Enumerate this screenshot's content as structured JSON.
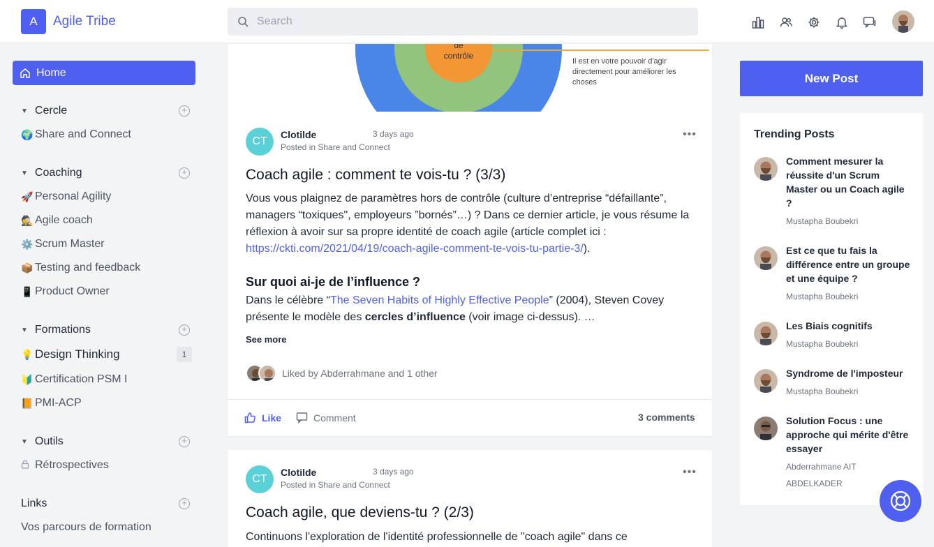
{
  "header": {
    "logo_letter": "A",
    "brand": "Agile Tribe",
    "search_placeholder": "Search",
    "icons": [
      "analytics-icon",
      "members-icon",
      "settings-icon",
      "bell-icon",
      "chat-icon"
    ]
  },
  "sidebar": {
    "home": "Home",
    "sections": [
      {
        "title": "Cercle",
        "items": [
          {
            "emoji": "🌍",
            "label": "Share and Connect"
          }
        ]
      },
      {
        "title": "Coaching",
        "items": [
          {
            "emoji": "🚀",
            "label": "Personal Agility"
          },
          {
            "emoji": "🕵️",
            "label": "Agile coach"
          },
          {
            "emoji": "⚙️",
            "label": "Scrum Master"
          },
          {
            "emoji": "📦",
            "label": "Testing and feedback"
          },
          {
            "emoji": "📱",
            "label": "Product Owner"
          }
        ]
      },
      {
        "title": "Formations",
        "items": [
          {
            "emoji": "💡",
            "label": "Design Thinking",
            "badge": "1"
          },
          {
            "emoji": "🔰",
            "label": "Certification PSM I"
          },
          {
            "emoji": "📙",
            "label": "PMI-ACP"
          }
        ]
      },
      {
        "title": "Outils",
        "items": [
          {
            "emoji": "🔒",
            "label": "Rétrospectives"
          }
        ]
      }
    ],
    "links_title": "Links",
    "links": [
      "Vos parcours de formation"
    ]
  },
  "feed": {
    "image_label_1": "de",
    "image_label_2": "contrôle",
    "image_caption": "Il est en votre pouvoir d'agir directement pour améliorer les choses",
    "posts": [
      {
        "avatar": "CT",
        "author": "Clotilde",
        "time": "3 days ago",
        "posted_in": "Posted in Share and Connect",
        "title": "Coach agile : comment te vois-tu ? (3/3)",
        "body": "Vous vous plaignez de paramètres hors de contrôle (culture d’entreprise “défaillante”, managers “toxiques\", employeurs ”bornés”…) ? Dans ce dernier article, je vous résume la réflexion à avoir sur sa propre identité de coach agile (article complet ici : ",
        "link": "https://ckti.com/2021/04/19/coach-agile-comment-te-vois-tu-partie-3/",
        "body_end": ").",
        "subheading": "Sur quoi ai-je de l’influence ?",
        "para2_a": "Dans le célèbre “",
        "para2_link": "The Seven Habits of Highly Effective People",
        "para2_b": "” (2004), Steven Covey présente le modèle des ",
        "para2_bold": "cercles d’influence",
        "para2_c": " (voir image ci-dessus). …",
        "see_more": "See more",
        "liked_by": "Liked by Abderrahmane and 1 other",
        "like": "Like",
        "comment": "Comment",
        "comments_count": "3 comments"
      },
      {
        "avatar": "CT",
        "author": "Clotilde",
        "time": "3 days ago",
        "posted_in": "Posted in Share and Connect",
        "title": "Coach agile, que deviens-tu ? (2/3)",
        "body": "Continuons l'exploration de l'identité professionnelle de \"coach agile\" dans ce"
      }
    ]
  },
  "right": {
    "new_post": "New Post",
    "trending_title": "Trending Posts",
    "trending": [
      {
        "title": "Comment mesurer la réussite d'un Scrum Master ou un Coach agile ?",
        "author": "Mustapha Boubekri"
      },
      {
        "title": "Est ce que tu fais la différence entre un groupe et une équipe ?",
        "author": "Mustapha Boubekri"
      },
      {
        "title": "Les Biais cognitifs",
        "author": "Mustapha Boubekri"
      },
      {
        "title": "Syndrome de l'imposteur",
        "author": "Mustapha Boubekri"
      },
      {
        "title": "Solution Focus : une approche qui mérite d'être essayer",
        "author": "Abderrahmane AIT ABDELKADER"
      }
    ]
  },
  "colors": {
    "accent": "#4f5ff0",
    "avatar_ct": "#5ad1d6",
    "link": "#4f5ff0"
  }
}
